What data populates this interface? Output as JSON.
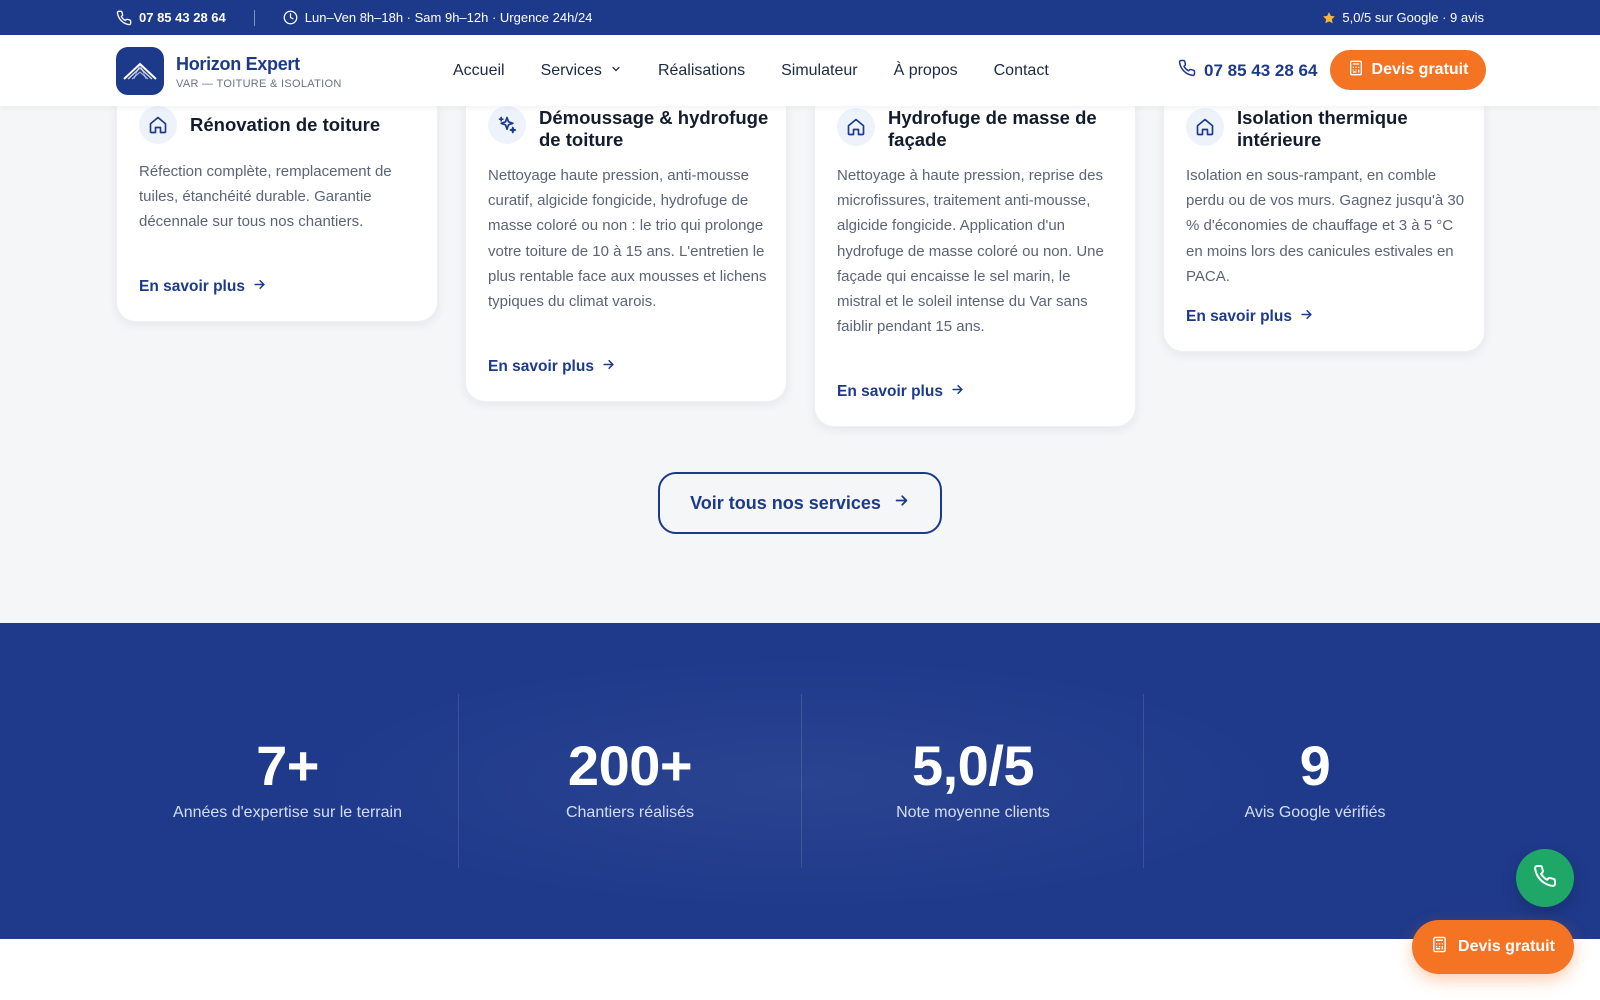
{
  "topbar": {
    "phone": "07 85 43 28 64",
    "hours": "Lun–Ven 8h–18h · Sam 9h–12h · Urgence 24h/24",
    "rating": "5,0/5 sur Google · 9 avis"
  },
  "header": {
    "brand_name": "Horizon Expert",
    "brand_tagline": "VAR — TOITURE & ISOLATION",
    "nav": {
      "home": "Accueil",
      "services": "Services",
      "realisations": "Réalisations",
      "simulateur": "Simulateur",
      "about": "À propos",
      "contact": "Contact"
    },
    "phone": "07 85 43 28 64",
    "cta": "Devis gratuit"
  },
  "services": [
    {
      "title": "Rénovation de toiture",
      "icon": "home-icon",
      "description": "Réfection complète, remplacement de tuiles, étanchéité durable. Garantie décennale sur tous nos chantiers.",
      "link": "En savoir plus"
    },
    {
      "title": "Démoussage & hydrofuge de toiture",
      "icon": "sparkles-icon",
      "description": "Nettoyage haute pression, anti-mousse curatif, algicide fongicide, hydrofuge de masse coloré ou non : le trio qui prolonge votre toiture de 10 à 15 ans. L'entretien le plus rentable face aux mousses et lichens typiques du climat varois.",
      "link": "En savoir plus"
    },
    {
      "title": "Hydrofuge de masse de façade",
      "icon": "home-icon",
      "description": "Nettoyage à haute pression, reprise des microfissures, traitement anti-mousse, algicide fongicide. Application d'un hydrofuge de masse coloré ou non. Une façade qui encaisse le sel marin, le mistral et le soleil intense du Var sans faiblir pendant 15 ans.",
      "link": "En savoir plus"
    },
    {
      "title": "Isolation thermique intérieure",
      "icon": "home-icon",
      "description": "Isolation en sous-rampant, en comble perdu ou de vos murs. Gagnez jusqu'à 30 % d'économies de chauffage et 3 à 5 °C en moins lors des canicules estivales en PACA.",
      "link": "En savoir plus"
    }
  ],
  "all_services_button": "Voir tous nos services",
  "stats": [
    {
      "value": "7+",
      "label": "Années d'expertise sur le terrain"
    },
    {
      "value": "200+",
      "label": "Chantiers réalisés"
    },
    {
      "value": "5,0/5",
      "label": "Note moyenne clients"
    },
    {
      "value": "9",
      "label": "Avis Google vérifiés"
    }
  ],
  "floating": {
    "devis": "Devis gratuit"
  },
  "colors": {
    "primary": "#1d3a8a",
    "accent": "#f57424",
    "call_green": "#1fa768"
  }
}
